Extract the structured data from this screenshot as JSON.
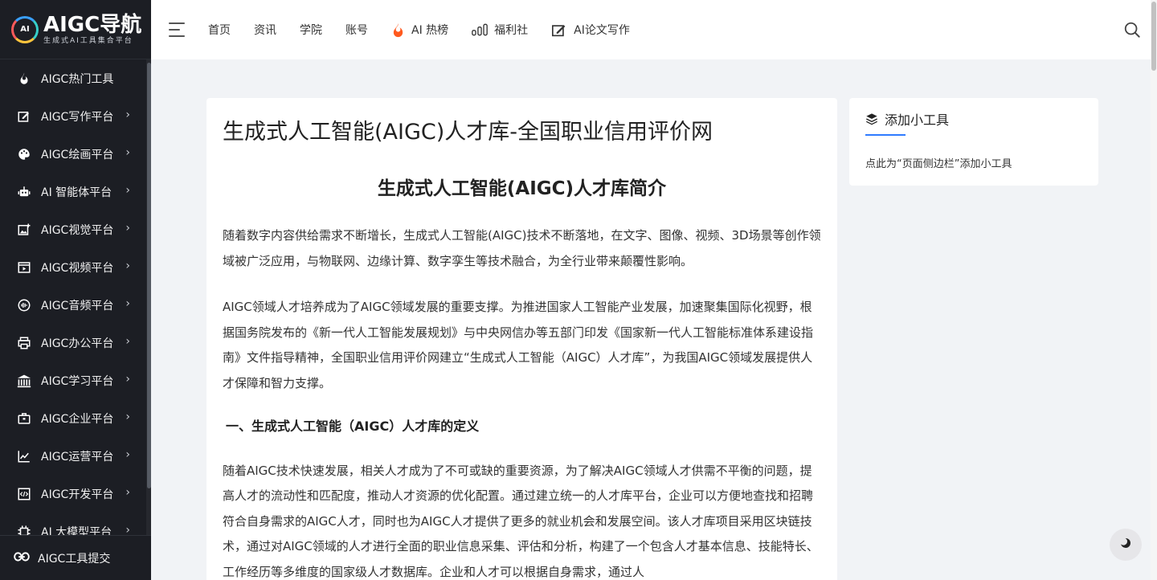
{
  "logo": {
    "mark": "AI",
    "title": "AIGC导航",
    "subtitle": "生成式AI工具集合平台"
  },
  "sidebar": {
    "items": [
      {
        "label": "AIGC热门工具",
        "icon": "flame-icon",
        "arrow": false
      },
      {
        "label": "AIGC写作平台",
        "icon": "edit-icon",
        "arrow": true
      },
      {
        "label": "AIGC绘画平台",
        "icon": "palette-icon",
        "arrow": true
      },
      {
        "label": "AI 智能体平台",
        "icon": "robot-icon",
        "arrow": true
      },
      {
        "label": "AIGC视觉平台",
        "icon": "image-icon",
        "arrow": true
      },
      {
        "label": "AIGC视频平台",
        "icon": "video-icon",
        "arrow": true
      },
      {
        "label": "AIGC音频平台",
        "icon": "audio-icon",
        "arrow": true
      },
      {
        "label": "AIGC办公平台",
        "icon": "printer-icon",
        "arrow": true
      },
      {
        "label": "AIGC学习平台",
        "icon": "institution-icon",
        "arrow": true
      },
      {
        "label": "AIGC企业平台",
        "icon": "briefcase-icon",
        "arrow": true
      },
      {
        "label": "AIGC运营平台",
        "icon": "chart-line-icon",
        "arrow": true
      },
      {
        "label": "AIGC开发平台",
        "icon": "code-icon",
        "arrow": true
      },
      {
        "label": "AI 大模型平台",
        "icon": "model-icon",
        "arrow": true
      }
    ],
    "arrow_glyph": "›",
    "submit_label": "AIGC工具提交"
  },
  "header": {
    "nav": [
      {
        "label": "首页"
      },
      {
        "label": "资讯"
      },
      {
        "label": "学院"
      },
      {
        "label": "账号"
      },
      {
        "label": "AI 热榜",
        "icon": "fire-icon"
      },
      {
        "label": "福利社",
        "icon": "bars-icon"
      },
      {
        "label": "AI论文写作",
        "icon": "write-icon"
      }
    ]
  },
  "article": {
    "title": "生成式人工智能(AIGC)人才库-全国职业信用评价网",
    "subtitle": "生成式人工智能(AIGC)人才库简介",
    "p1": "随着数字内容供给需求不断增长，生成式人工智能(AIGC)技术不断落地，在文字、图像、视频、3D场景等创作领域被广泛应用，与物联网、边缘计算、数字孪生等技术融合，为全行业带来颠覆性影响。",
    "p2": "AIGC领域人才培养成为了AIGC领域发展的重要支撑。为推进国家人工智能产业发展，加速聚集国际化视野，根据国务院发布的《新一代人工智能发展规划》与中央网信办等五部门印发《国家新一代人工智能标准体系建设指南》文件指导精神，全国职业信用评价网建立“生成式人工智能（AIGC）人才库”，为我国AIGC领域发展提供人才保障和智力支撑。",
    "section1": "一、生成式人工智能（AIGC）人才库的定义",
    "p3": "随着AIGC技术快速发展，相关人才成为了不可或缺的重要资源，为了解决AIGC领域人才供需不平衡的问题，提高人才的流动性和匹配度，推动人才资源的优化配置。通过建立统一的人才库平台，企业可以方便地查找和招聘符合自身需求的AIGC人才，同时也为AIGC人才提供了更多的就业机会和发展空间。该人才库项目采用区块链技术，通过对AIGC领域的人才进行全面的职业信息采集、评估和分析，构建了一个包含人才基本信息、技能特长、工作经历等多维度的国家级人才数据库。企业和人才可以根据自身需求，通过人"
  },
  "widget": {
    "title": "添加小工具",
    "text": "点此为“页面侧边栏”添加小工具"
  },
  "colors": {
    "sidebar_bg": "#1c1e24",
    "accent": "#2f7bff",
    "fire": "#ff5a1f"
  }
}
